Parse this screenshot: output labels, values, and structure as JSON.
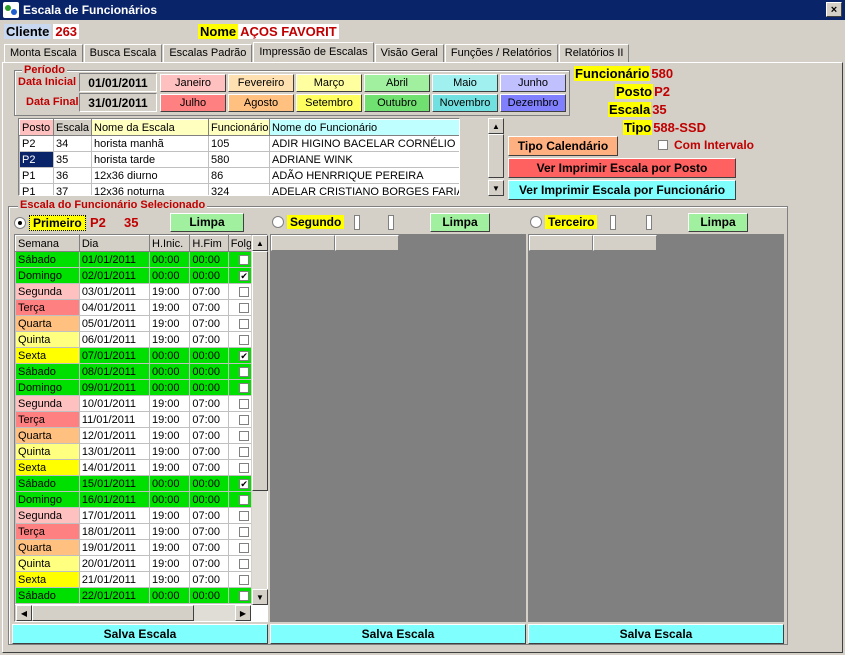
{
  "window": {
    "title": "Escala de Funcionários",
    "close": "×"
  },
  "header": {
    "cliente_label": "Cliente",
    "cliente_value": "263",
    "nome_label": "Nome",
    "nome_value": "AÇOS FAVORIT"
  },
  "tabs": [
    "Monta Escala",
    "Busca Escala",
    "Escalas Padrão",
    "Impressão de Escalas",
    "Visão Geral",
    "Funções / Relatórios",
    "Relatórios II"
  ],
  "active_tab": 3,
  "periodo": {
    "label": "Período",
    "data_inicial_label": "Data Inicial",
    "data_inicial": "01/01/2011",
    "data_final_label": "Data Final",
    "data_final": "31/01/2011",
    "months": [
      {
        "label": "Janeiro",
        "color": "#ffc0c0"
      },
      {
        "label": "Fevereiro",
        "color": "#ffe0b0"
      },
      {
        "label": "Março",
        "color": "#ffffa0"
      },
      {
        "label": "Abril",
        "color": "#a0f0a0"
      },
      {
        "label": "Maio",
        "color": "#a0f0f0"
      },
      {
        "label": "Junho",
        "color": "#c0c0ff"
      },
      {
        "label": "Julho",
        "color": "#ff8080"
      },
      {
        "label": "Agosto",
        "color": "#ffc080"
      },
      {
        "label": "Setembro",
        "color": "#ffff60"
      },
      {
        "label": "Outubro",
        "color": "#70e070"
      },
      {
        "label": "Novembro",
        "color": "#70e0e0"
      },
      {
        "label": "Dezembro",
        "color": "#8080ff"
      }
    ]
  },
  "info": {
    "funcionario_label": "Funcionário",
    "funcionario_value": "580",
    "posto_label": "Posto",
    "posto_value": "P2",
    "escala_label": "Escala",
    "escala_value": "35",
    "tipo_label": "Tipo",
    "tipo_value": "588-SSD"
  },
  "escalas_table": {
    "columns": [
      "Posto",
      "Escala",
      "Nome da  Escala",
      "Funcionário",
      "Nome do Funcionário"
    ],
    "rows": [
      [
        "P2",
        "34",
        "horista manhã",
        "105",
        "ADIR HIGINO BACELAR CORNÉLIO !"
      ],
      [
        "P2",
        "35",
        "horista tarde",
        "580",
        "ADRIANE WINK"
      ],
      [
        "P1",
        "36",
        "12x36 diurno",
        "86",
        "ADÃO HENRRIQUE PEREIRA"
      ],
      [
        "P1",
        "37",
        "12x36 noturna",
        "324",
        "ADELAR CRISTIANO BORGES FARIA"
      ]
    ],
    "selected_row": 1
  },
  "actions": {
    "tipo_calendario": "Tipo Calendário",
    "com_intervalo": "Com Intervalo",
    "ver_posto": "Ver Imprimir Escala por Posto",
    "ver_funcionario": "Ver Imprimir Escala por Funcionário"
  },
  "selecionado": {
    "label": "Escala do Funcionário Selecionado",
    "primeiro": {
      "label": "Primeiro",
      "posto": "P2",
      "escala": "35",
      "limpa": "Limpa"
    },
    "segundo": {
      "label": "Segundo",
      "limpa": "Limpa"
    },
    "terceiro": {
      "label": "Terceiro",
      "limpa": "Limpa"
    },
    "salva": "Salva Escala"
  },
  "schedule": {
    "columns": [
      "Semana",
      "Dia",
      "H.Inic.",
      "H.Fim",
      "Folga"
    ],
    "colors": {
      "Sábado": "#00e000",
      "Domingo": "#00e000",
      "Segunda": "#ffc0c0",
      "Terça": "#ff8080",
      "Quarta": "#ffc080",
      "Quinta": "#ffff80",
      "Sexta": "#ffff00"
    },
    "folga_color": "#00e000",
    "rows": [
      [
        "Sábado",
        "01/01/2011",
        "00:00",
        "00:00",
        false,
        true
      ],
      [
        "Domingo",
        "02/01/2011",
        "00:00",
        "00:00",
        true,
        true
      ],
      [
        "Segunda",
        "03/01/2011",
        "19:00",
        "07:00",
        false,
        false
      ],
      [
        "Terça",
        "04/01/2011",
        "19:00",
        "07:00",
        false,
        false
      ],
      [
        "Quarta",
        "05/01/2011",
        "19:00",
        "07:00",
        false,
        false
      ],
      [
        "Quinta",
        "06/01/2011",
        "19:00",
        "07:00",
        false,
        false
      ],
      [
        "Sexta",
        "07/01/2011",
        "00:00",
        "00:00",
        true,
        true
      ],
      [
        "Sábado",
        "08/01/2011",
        "00:00",
        "00:00",
        false,
        true
      ],
      [
        "Domingo",
        "09/01/2011",
        "00:00",
        "00:00",
        false,
        true
      ],
      [
        "Segunda",
        "10/01/2011",
        "19:00",
        "07:00",
        false,
        false
      ],
      [
        "Terça",
        "11/01/2011",
        "19:00",
        "07:00",
        false,
        false
      ],
      [
        "Quarta",
        "12/01/2011",
        "19:00",
        "07:00",
        false,
        false
      ],
      [
        "Quinta",
        "13/01/2011",
        "19:00",
        "07:00",
        false,
        false
      ],
      [
        "Sexta",
        "14/01/2011",
        "19:00",
        "07:00",
        false,
        false
      ],
      [
        "Sábado",
        "15/01/2011",
        "00:00",
        "00:00",
        true,
        true
      ],
      [
        "Domingo",
        "16/01/2011",
        "00:00",
        "00:00",
        false,
        true
      ],
      [
        "Segunda",
        "17/01/2011",
        "19:00",
        "07:00",
        false,
        false
      ],
      [
        "Terça",
        "18/01/2011",
        "19:00",
        "07:00",
        false,
        false
      ],
      [
        "Quarta",
        "19/01/2011",
        "19:00",
        "07:00",
        false,
        false
      ],
      [
        "Quinta",
        "20/01/2011",
        "19:00",
        "07:00",
        false,
        false
      ],
      [
        "Sexta",
        "21/01/2011",
        "19:00",
        "07:00",
        false,
        false
      ],
      [
        "Sábado",
        "22/01/2011",
        "00:00",
        "00:00",
        false,
        true
      ]
    ]
  }
}
